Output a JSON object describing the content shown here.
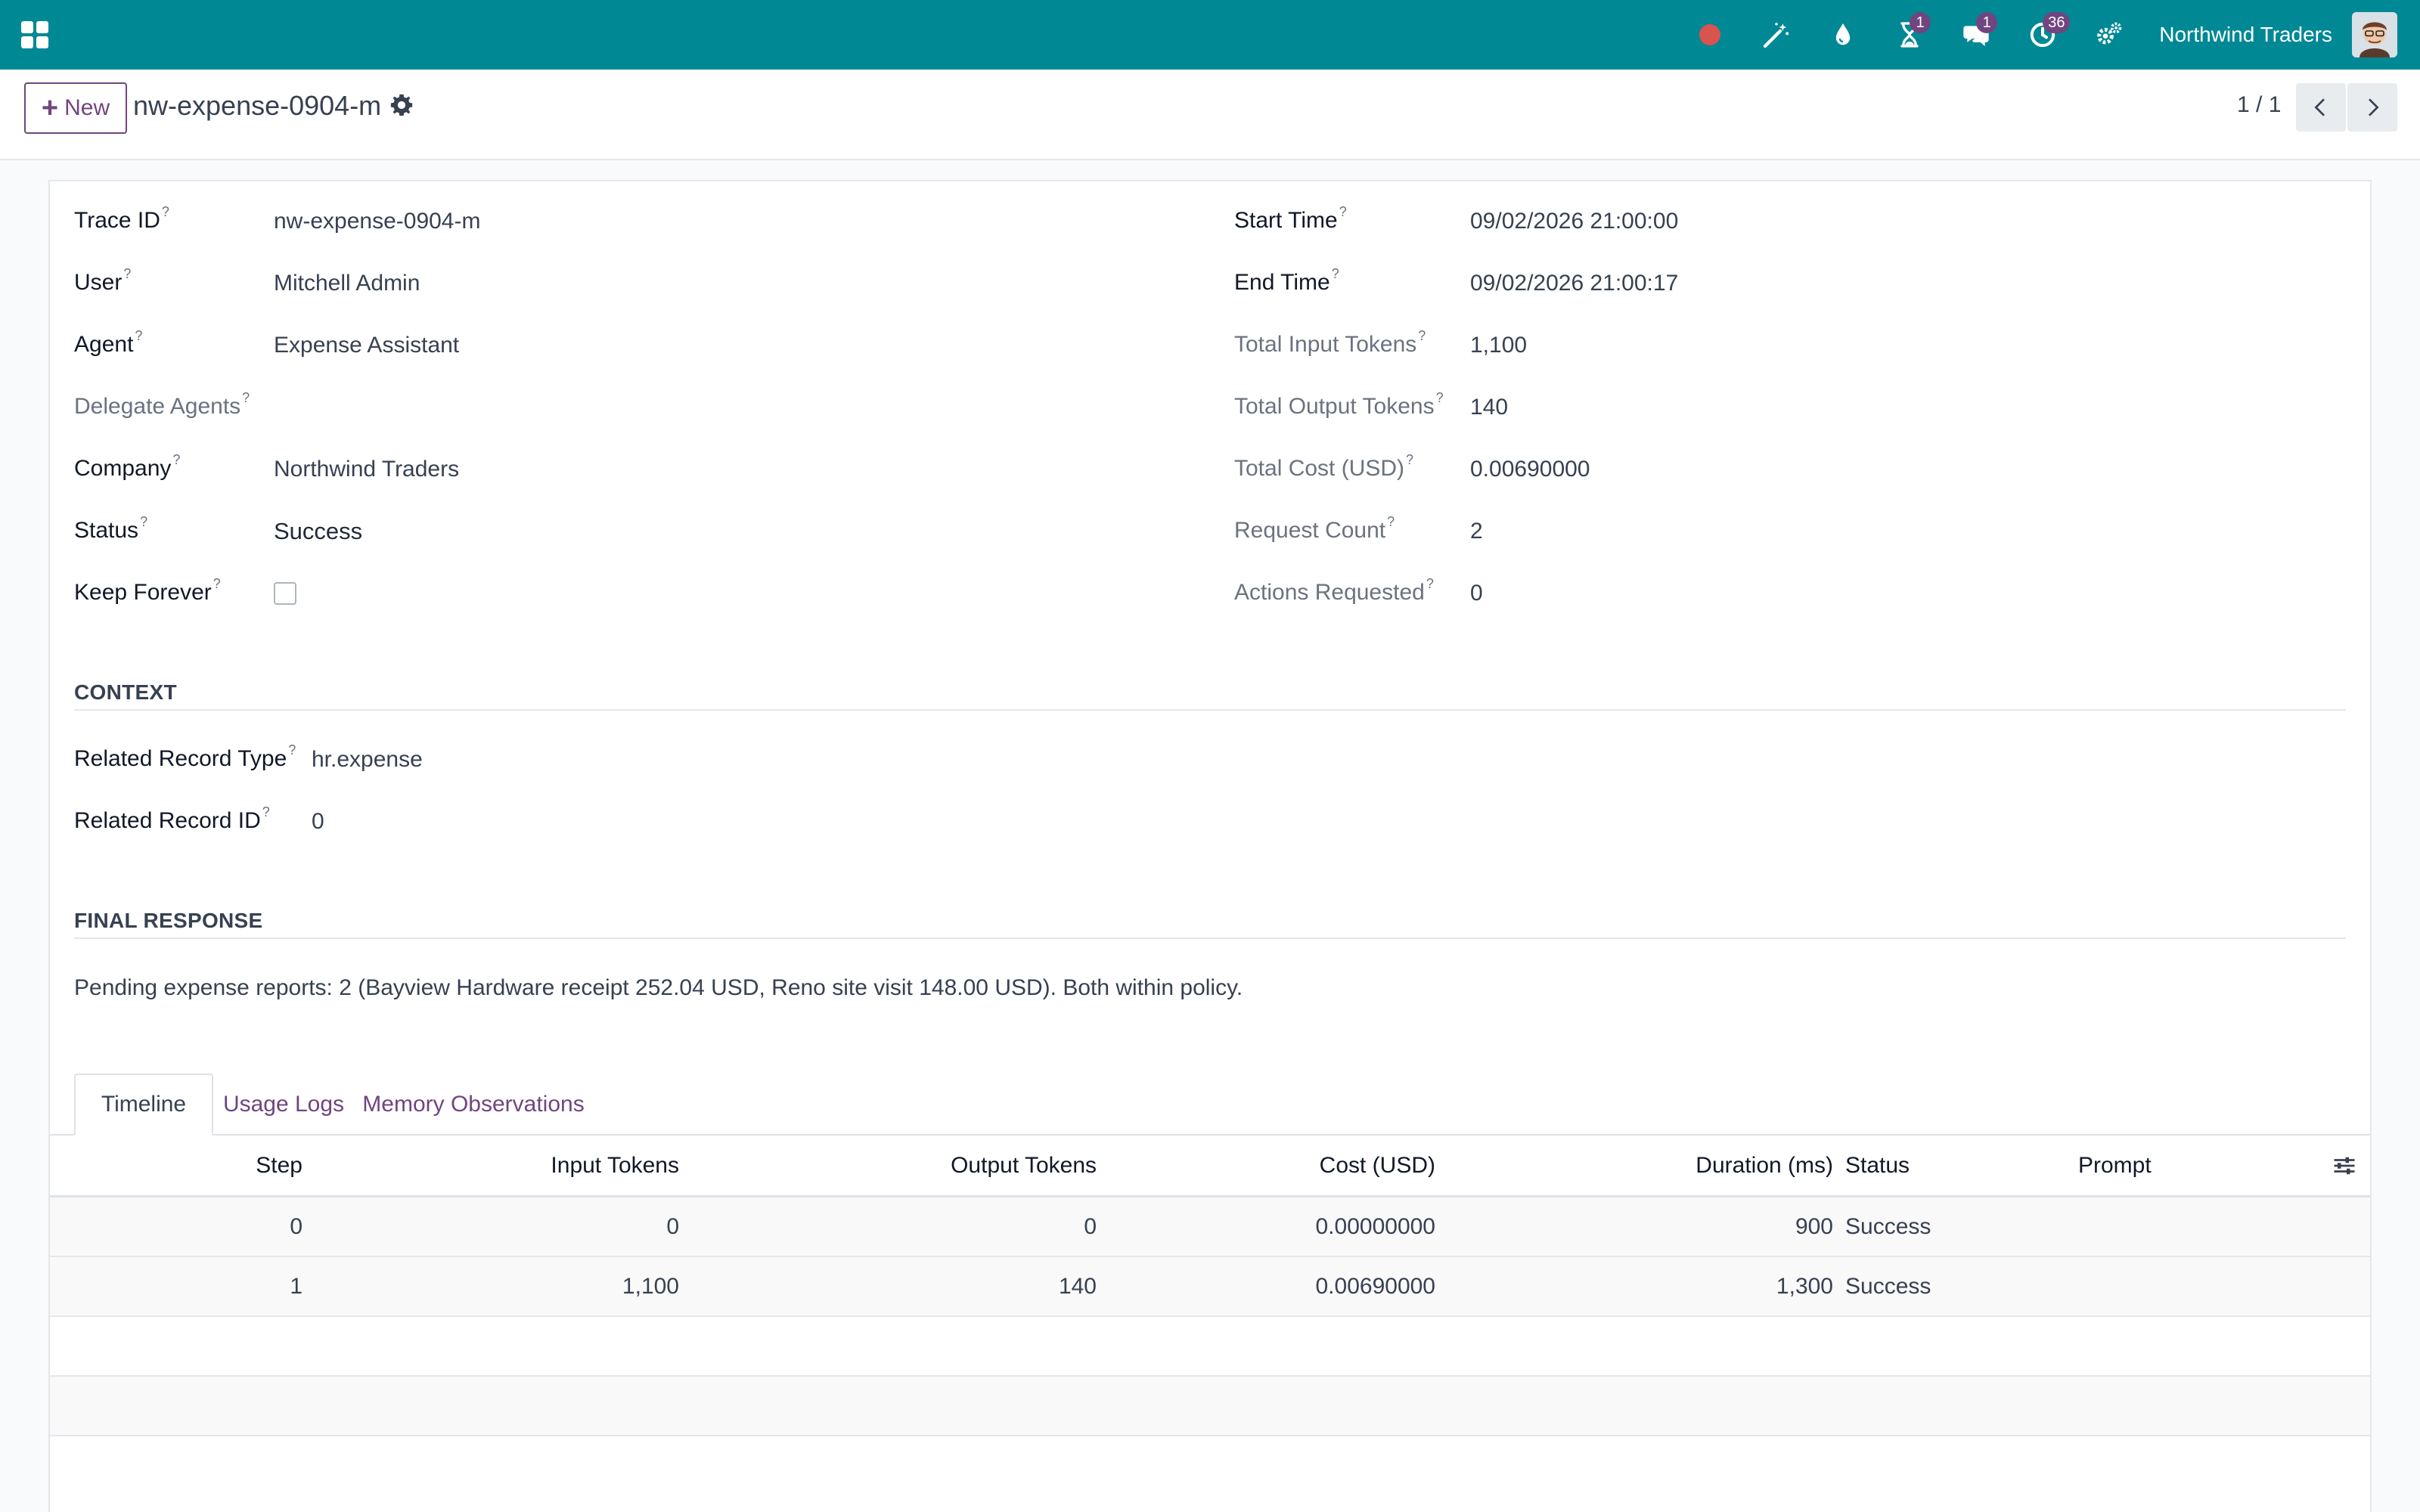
{
  "navbar": {
    "company": "Northwind Traders",
    "activity_badge": "1",
    "messages_badge": "1",
    "clock_badge": "36"
  },
  "control": {
    "new_label": "New",
    "record_title": "nw-expense-0904-m",
    "pager_value": "1 / 1"
  },
  "fields_left": [
    {
      "label": "Trace ID",
      "value": "nw-expense-0904-m"
    },
    {
      "label": "User",
      "value": "Mitchell Admin"
    },
    {
      "label": "Agent",
      "value": "Expense Assistant"
    },
    {
      "label": "Delegate Agents",
      "value": ""
    },
    {
      "label": "Company",
      "value": "Northwind Traders"
    },
    {
      "label": "Status",
      "value": "Success"
    },
    {
      "label": "Keep Forever",
      "value": ""
    }
  ],
  "fields_right": [
    {
      "label": "Start Time",
      "value": "09/02/2026 21:00:00"
    },
    {
      "label": "End Time",
      "value": "09/02/2026 21:00:17"
    },
    {
      "label": "Total Input Tokens",
      "value": "1,100"
    },
    {
      "label": "Total Output Tokens",
      "value": "140"
    },
    {
      "label": "Total Cost (USD)",
      "value": "0.00690000"
    },
    {
      "label": "Request Count",
      "value": "2"
    },
    {
      "label": "Actions Requested",
      "value": "0"
    }
  ],
  "context": {
    "title": "CONTEXT",
    "fields": [
      {
        "label": "Related Record Type",
        "value": "hr.expense"
      },
      {
        "label": "Related Record ID",
        "value": "0"
      }
    ]
  },
  "final_response": {
    "title": "FINAL RESPONSE",
    "text": "Pending expense reports: 2 (Bayview Hardware receipt 252.04 USD, Reno site visit 148.00 USD). Both within policy."
  },
  "tabs": [
    {
      "label": "Timeline"
    },
    {
      "label": "Usage Logs"
    },
    {
      "label": "Memory Observations"
    }
  ],
  "table": {
    "headers": [
      "Step",
      "Input Tokens",
      "Output Tokens",
      "Cost (USD)",
      "Duration (ms)",
      "Status",
      "Prompt"
    ],
    "rows": [
      [
        "0",
        "0",
        "0",
        "0.00000000",
        "900",
        "Success",
        ""
      ],
      [
        "1",
        "1,100",
        "140",
        "0.00690000",
        "1,300",
        "Success",
        ""
      ]
    ]
  },
  "colors": {
    "navbar": "#018895",
    "brand": "#71457f",
    "badge": "#71457f",
    "record_dot": "#d9534f"
  }
}
